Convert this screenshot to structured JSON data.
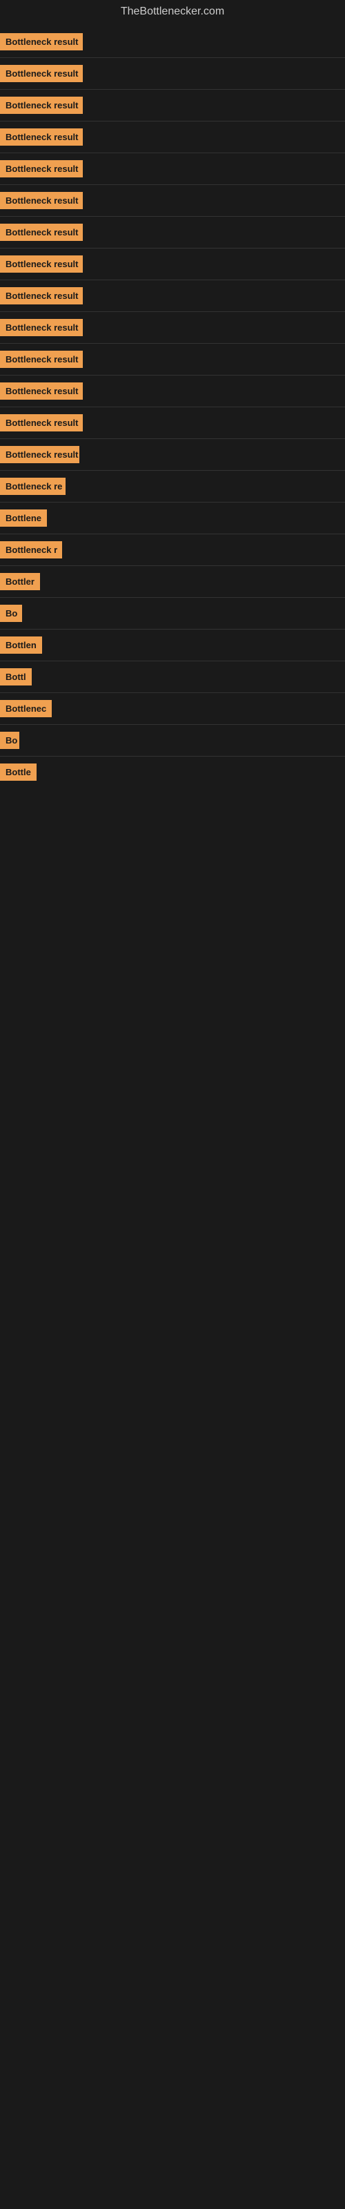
{
  "site": {
    "title": "TheBottlenecker.com"
  },
  "items": [
    {
      "id": 1,
      "label": "Bottleneck result",
      "badge_width": 120
    },
    {
      "id": 2,
      "label": "Bottleneck result",
      "badge_width": 120
    },
    {
      "id": 3,
      "label": "Bottleneck result",
      "badge_width": 120
    },
    {
      "id": 4,
      "label": "Bottleneck result",
      "badge_width": 120
    },
    {
      "id": 5,
      "label": "Bottleneck result",
      "badge_width": 120
    },
    {
      "id": 6,
      "label": "Bottleneck result",
      "badge_width": 120
    },
    {
      "id": 7,
      "label": "Bottleneck result",
      "badge_width": 120
    },
    {
      "id": 8,
      "label": "Bottleneck result",
      "badge_width": 120
    },
    {
      "id": 9,
      "label": "Bottleneck result",
      "badge_width": 120
    },
    {
      "id": 10,
      "label": "Bottleneck result",
      "badge_width": 120
    },
    {
      "id": 11,
      "label": "Bottleneck result",
      "badge_width": 120
    },
    {
      "id": 12,
      "label": "Bottleneck result",
      "badge_width": 120
    },
    {
      "id": 13,
      "label": "Bottleneck result",
      "badge_width": 120
    },
    {
      "id": 14,
      "label": "Bottleneck result",
      "badge_width": 115
    },
    {
      "id": 15,
      "label": "Bottleneck re",
      "badge_width": 95
    },
    {
      "id": 16,
      "label": "Bottlene",
      "badge_width": 75
    },
    {
      "id": 17,
      "label": "Bottleneck r",
      "badge_width": 90
    },
    {
      "id": 18,
      "label": "Bottler",
      "badge_width": 65
    },
    {
      "id": 19,
      "label": "Bo",
      "badge_width": 32
    },
    {
      "id": 20,
      "label": "Bottlen",
      "badge_width": 72
    },
    {
      "id": 21,
      "label": "Bottl",
      "badge_width": 55
    },
    {
      "id": 22,
      "label": "Bottlenec",
      "badge_width": 80
    },
    {
      "id": 23,
      "label": "Bo",
      "badge_width": 28
    },
    {
      "id": 24,
      "label": "Bottle",
      "badge_width": 60
    }
  ]
}
